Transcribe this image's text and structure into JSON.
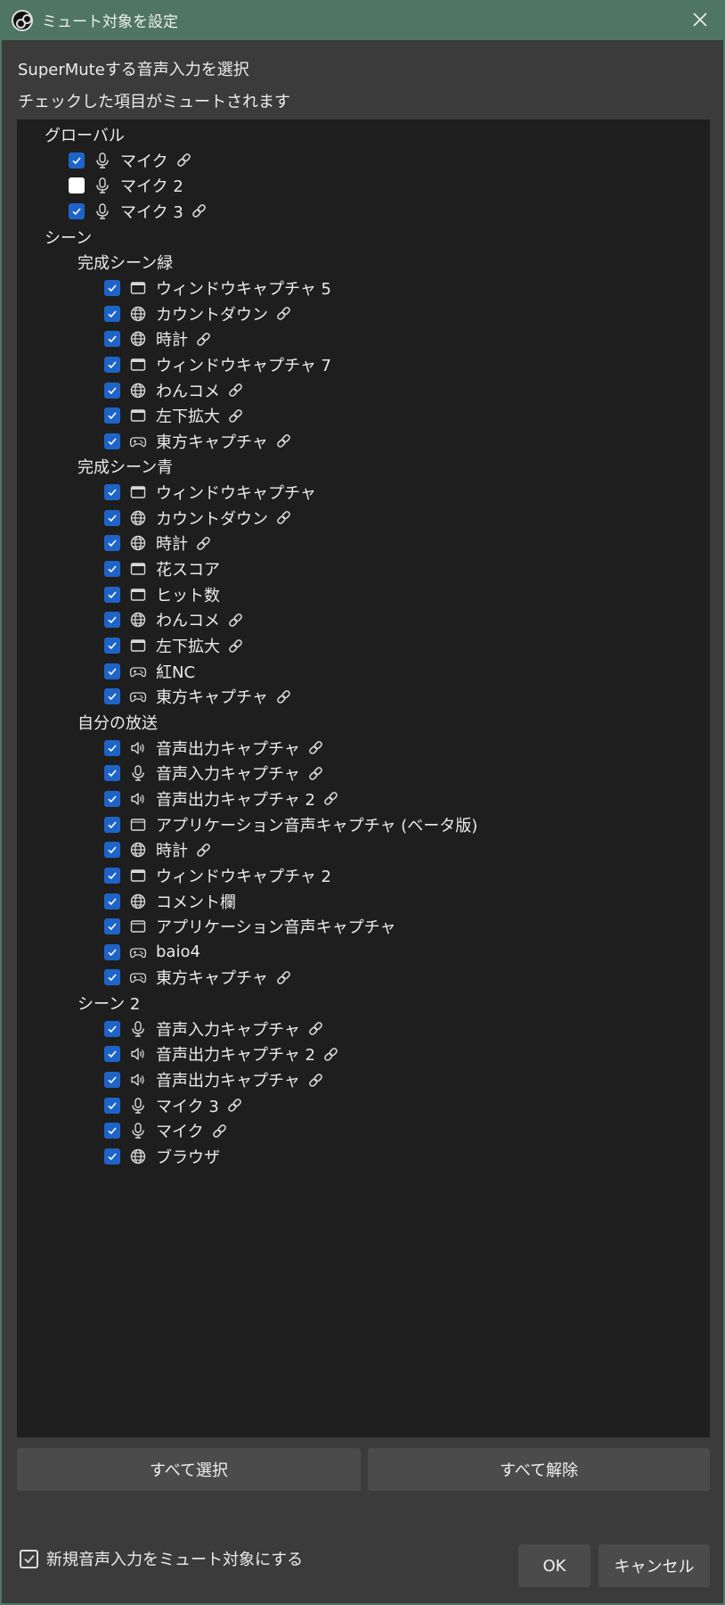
{
  "window": {
    "title": "ミュート対象を設定"
  },
  "desc": {
    "line1": "SuperMuteする音声入力を選択",
    "line2": "チェックした項目がミュートされます"
  },
  "global": {
    "label": "グローバル",
    "items": [
      {
        "label": "マイク",
        "checked": true,
        "icon": "mic-icon",
        "linked": true
      },
      {
        "label": "マイク 2",
        "checked": false,
        "icon": "mic-icon",
        "linked": false
      },
      {
        "label": "マイク 3",
        "checked": true,
        "icon": "mic-icon",
        "linked": true
      }
    ]
  },
  "scenes": {
    "label": "シーン",
    "groups": [
      {
        "label": "完成シーン緑",
        "items": [
          {
            "label": "ウィンドウキャプチャ 5",
            "checked": true,
            "icon": "window-icon",
            "linked": false
          },
          {
            "label": "カウントダウン",
            "checked": true,
            "icon": "globe-icon",
            "linked": true
          },
          {
            "label": "時計",
            "checked": true,
            "icon": "globe-icon",
            "linked": true
          },
          {
            "label": "ウィンドウキャプチャ 7",
            "checked": true,
            "icon": "window-icon",
            "linked": false
          },
          {
            "label": "わんコメ",
            "checked": true,
            "icon": "globe-icon",
            "linked": true
          },
          {
            "label": "左下拡大",
            "checked": true,
            "icon": "window-icon",
            "linked": true
          },
          {
            "label": "東方キャプチャ",
            "checked": true,
            "icon": "gamepad-icon",
            "linked": true
          }
        ]
      },
      {
        "label": "完成シーン青",
        "items": [
          {
            "label": "ウィンドウキャプチャ",
            "checked": true,
            "icon": "window-icon",
            "linked": false
          },
          {
            "label": "カウントダウン",
            "checked": true,
            "icon": "globe-icon",
            "linked": true
          },
          {
            "label": "時計",
            "checked": true,
            "icon": "globe-icon",
            "linked": true
          },
          {
            "label": "花スコア",
            "checked": true,
            "icon": "window-icon",
            "linked": false
          },
          {
            "label": "ヒット数",
            "checked": true,
            "icon": "window-icon",
            "linked": false
          },
          {
            "label": "わんコメ",
            "checked": true,
            "icon": "globe-icon",
            "linked": true
          },
          {
            "label": "左下拡大",
            "checked": true,
            "icon": "window-icon",
            "linked": true
          },
          {
            "label": "紅NC",
            "checked": true,
            "icon": "gamepad-icon",
            "linked": false
          },
          {
            "label": "東方キャプチャ",
            "checked": true,
            "icon": "gamepad-icon",
            "linked": true
          }
        ]
      },
      {
        "label": "自分の放送",
        "items": [
          {
            "label": "音声出力キャプチャ",
            "checked": true,
            "icon": "speaker-icon",
            "linked": true
          },
          {
            "label": "音声入力キャプチャ",
            "checked": true,
            "icon": "mic-icon",
            "linked": true
          },
          {
            "label": "音声出力キャプチャ 2",
            "checked": true,
            "icon": "speaker-icon",
            "linked": true
          },
          {
            "label": "アプリケーション音声キャプチャ (ベータ版)",
            "checked": true,
            "icon": "app-window-icon",
            "linked": false
          },
          {
            "label": "時計",
            "checked": true,
            "icon": "globe-icon",
            "linked": true
          },
          {
            "label": "ウィンドウキャプチャ 2",
            "checked": true,
            "icon": "window-icon",
            "linked": false
          },
          {
            "label": "コメント欄",
            "checked": true,
            "icon": "globe-icon",
            "linked": false
          },
          {
            "label": "アプリケーション音声キャプチャ",
            "checked": true,
            "icon": "app-window-icon",
            "linked": false
          },
          {
            "label": "baio4",
            "checked": true,
            "icon": "gamepad-icon",
            "linked": false
          },
          {
            "label": "東方キャプチャ",
            "checked": true,
            "icon": "gamepad-icon",
            "linked": true
          }
        ]
      },
      {
        "label": "シーン 2",
        "items": [
          {
            "label": "音声入力キャプチャ",
            "checked": true,
            "icon": "mic-icon",
            "linked": true
          },
          {
            "label": "音声出力キャプチャ 2",
            "checked": true,
            "icon": "speaker-icon",
            "linked": true
          },
          {
            "label": "音声出力キャプチャ",
            "checked": true,
            "icon": "speaker-icon",
            "linked": true
          },
          {
            "label": "マイク 3",
            "checked": true,
            "icon": "mic-icon",
            "linked": true
          },
          {
            "label": "マイク",
            "checked": true,
            "icon": "mic-icon",
            "linked": true
          },
          {
            "label": "ブラウザ",
            "checked": true,
            "icon": "globe-icon",
            "linked": false
          }
        ]
      }
    ]
  },
  "buttons": {
    "select_all": "すべて選択",
    "deselect_all": "すべて解除",
    "ok": "OK",
    "cancel": "キャンセル"
  },
  "new_sources": {
    "label": "新規音声入力をミュート対象にする",
    "checked": true
  },
  "colors": {
    "titlebar": "#4f7566",
    "checkbox_on": "#1e64c8",
    "tree_bg": "#1e1e1e",
    "window_bg": "#3b3b3b"
  }
}
